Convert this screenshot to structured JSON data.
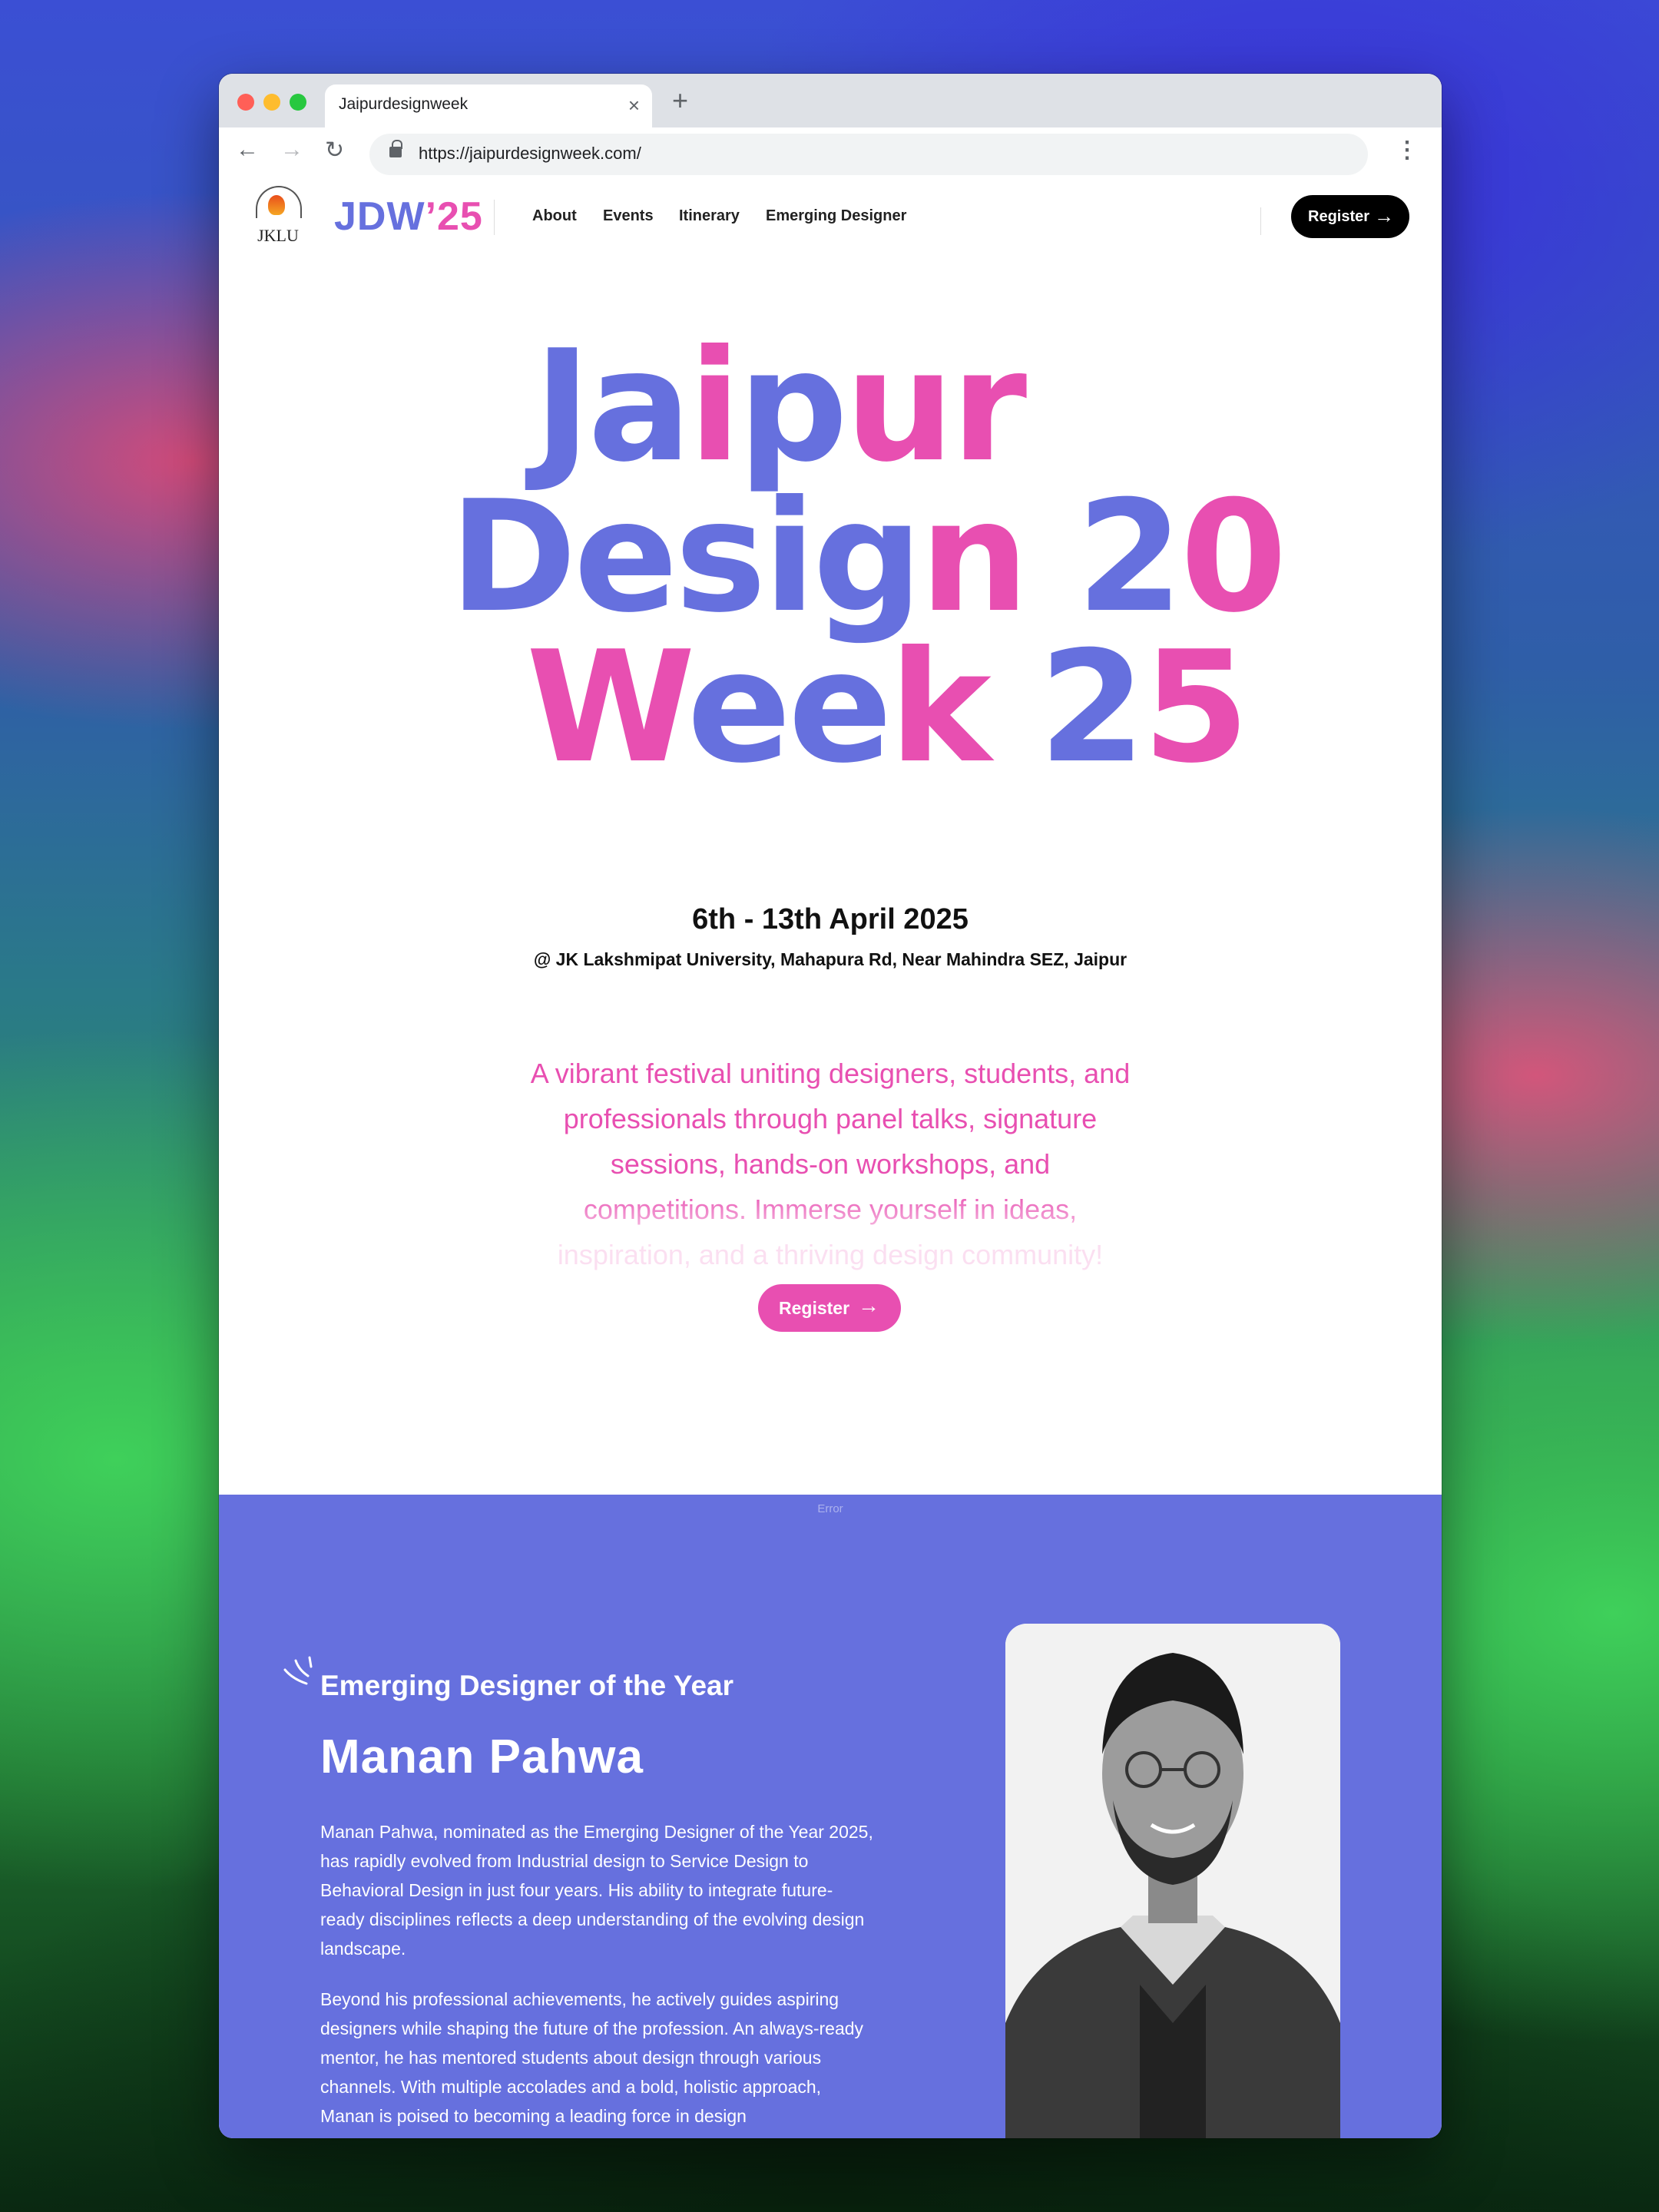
{
  "browser": {
    "tab_title": "Jaipurdesignweek",
    "tab_close": "×",
    "new_tab": "+",
    "url": "https://jaipurdesignweek.com/",
    "back": "←",
    "forward": "→",
    "reload": "↻",
    "menu": "⋮"
  },
  "header": {
    "jklu_logo_text": "JKLU",
    "brand_main": "JDW",
    "brand_year": "’25",
    "nav": [
      "About",
      "Events",
      "Itinerary",
      "Emerging Designer"
    ],
    "register_label": "Register",
    "register_icon": "arrow-right-icon"
  },
  "hero": {
    "title_line1": "Jaipur",
    "title_line2": "Design 20",
    "title_line3": "Week 25",
    "dates": "6th - 13th April 2025",
    "venue": "@ JK Lakshmipat University, Mahapura Rd, Near Mahindra SEZ, Jaipur",
    "description": "A vibrant festival uniting designers, students, and professionals through panel talks, signature sessions, hands-on workshops, and competitions. Immerse yourself in ideas, inspiration, and a thriving design community!",
    "register_label": "Register"
  },
  "emerging": {
    "error_text": "Error",
    "eyebrow": "Emerging Designer of the Year",
    "name": "Manan Pahwa",
    "bio_1": "Manan Pahwa, nominated as the Emerging Designer of the Year 2025, has rapidly evolved from Industrial design to Service Design to Behavioral Design in just four years. His ability to integrate future-ready disciplines reflects a deep understanding of the evolving design landscape.",
    "bio_2": "Beyond his professional achievements, he actively guides aspiring designers while shaping the future of the profession. An always-ready mentor, he has mentored students about design through various channels. With multiple accolades and a bold, holistic approach, Manan is poised to becoming a leading force in design"
  },
  "colors": {
    "brand_blue": "#6670de",
    "brand_pink": "#e84fb1",
    "black": "#000000"
  }
}
